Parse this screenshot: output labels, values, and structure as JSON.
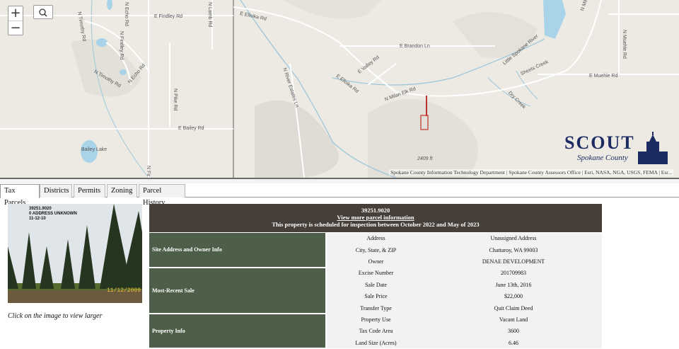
{
  "map": {
    "zoom_in": "+",
    "zoom_out": "−",
    "roads": [
      "N Timothy Rd",
      "N Echo Rd",
      "E Findley Rd",
      "N Findley Rd",
      "N Echo Rd",
      "N Timothy Rd",
      "N Pike Rd",
      "E Bailey Rd",
      "N Fir",
      "E Elloika Rd",
      "E Brandon Ln",
      "E Valley Rd",
      "N River Estates Ln",
      "E Elloika Rd",
      "N Milan Elk Rd",
      "Little Spokane River",
      "Sheets Creek",
      "E Muehle Rd",
      "N Muehle Rd",
      "N Milan Elk Rd",
      "Dry Creek",
      "N Lamb Rd"
    ],
    "lakes": [
      "Bailey Lake"
    ],
    "elevation": "2409 ft",
    "attribution": "Spokane County Information Technology Department | Spokane County Assessors Office | Esri, NASA, NGA, USGS, FEMA | Esr...",
    "logo": {
      "title": "SCOUT",
      "subtitle": "Spokane County"
    },
    "colors": {
      "parcel": "#c0302c",
      "logo": "#1d2b63",
      "land": "#eceae3",
      "water": "#a9d3e8"
    }
  },
  "tabs": [
    "Tax Parcels",
    "Districts",
    "Permits",
    "Zoning",
    "Parcel History"
  ],
  "photo": {
    "line1": "39251.9020",
    "line2": "0    ADDRESS UNKNOWN",
    "line3": "11-12-10",
    "date": "11/12/2009",
    "caption": "Click on the image to view larger"
  },
  "parcel": {
    "number": "39251.9020",
    "link": "View more parcel information",
    "notice": "This property is scheduled for inspection between October 2022 and May of 2023",
    "sections": [
      {
        "title": "Site Address and Owner Info",
        "rows": [
          {
            "field": "Address",
            "value": "Unassigned Address"
          },
          {
            "field": "City, State, & ZIP",
            "value": "Chattaroy, WA 99003"
          },
          {
            "field": "Owner",
            "value": "DENAE DEVELOPMENT"
          }
        ]
      },
      {
        "title": "Most-Recent Sale",
        "rows": [
          {
            "field": "Excise Number",
            "value": "201709983"
          },
          {
            "field": "Sale Date",
            "value": "June 13th, 2016"
          },
          {
            "field": "Sale Price",
            "value": "$22,000"
          },
          {
            "field": "Transfer Type",
            "value": "Quit Claim Deed"
          }
        ]
      },
      {
        "title": "Property Info",
        "rows": [
          {
            "field": "Property Use",
            "value": "Vacant Land"
          },
          {
            "field": "Tax Code Area",
            "value": "3600"
          },
          {
            "field": "Land Size (Acres)",
            "value": "6.46"
          }
        ]
      }
    ]
  }
}
